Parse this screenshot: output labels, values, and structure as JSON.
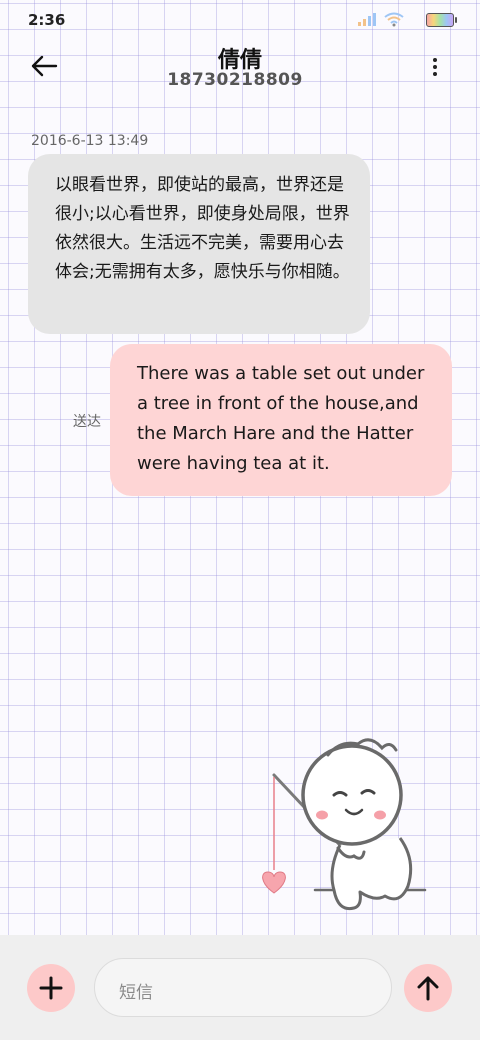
{
  "status_bar": {
    "time": "2:36"
  },
  "header": {
    "contact_name": "倩倩",
    "contact_number": "18730218809"
  },
  "conversation": {
    "timestamp": "2016-6-13 13:49",
    "incoming_message": "以眼看世界，即使站的最高，世界还是很小;以心看世界，即使身处局限，世界依然很大。生活远不完美，需要用心去体会;无需拥有太多，愿快乐与你相随。",
    "outgoing_message": "There was a table set out under a tree in front of the house,and the March Hare and the Hatter were having tea at it.",
    "delivery_status": "送达"
  },
  "composer": {
    "placeholder": "短信"
  },
  "colors": {
    "incoming_bubble": "#e5e5e5",
    "outgoing_bubble": "#fed5d5",
    "action_button": "#fdc9c9",
    "grid_line": "#968cdc"
  },
  "icons": [
    "back-arrow-icon",
    "more-vertical-icon",
    "signal-icon",
    "wifi-icon",
    "battery-icon",
    "plus-icon",
    "arrow-up-icon"
  ]
}
